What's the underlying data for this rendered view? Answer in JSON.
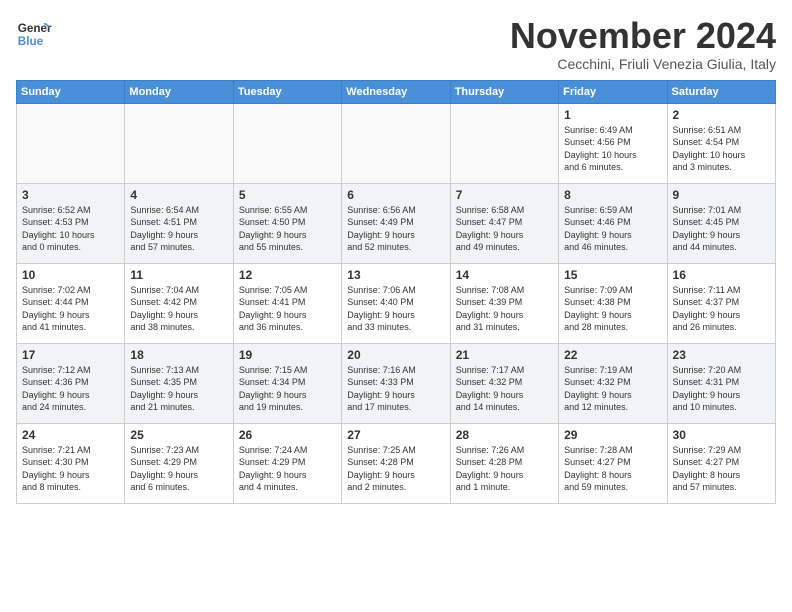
{
  "logo": {
    "line1": "General",
    "line2": "Blue"
  },
  "title": "November 2024",
  "subtitle": "Cecchini, Friuli Venezia Giulia, Italy",
  "days_of_week": [
    "Sunday",
    "Monday",
    "Tuesday",
    "Wednesday",
    "Thursday",
    "Friday",
    "Saturday"
  ],
  "weeks": [
    [
      {
        "day": "",
        "info": ""
      },
      {
        "day": "",
        "info": ""
      },
      {
        "day": "",
        "info": ""
      },
      {
        "day": "",
        "info": ""
      },
      {
        "day": "",
        "info": ""
      },
      {
        "day": "1",
        "info": "Sunrise: 6:49 AM\nSunset: 4:56 PM\nDaylight: 10 hours\nand 6 minutes."
      },
      {
        "day": "2",
        "info": "Sunrise: 6:51 AM\nSunset: 4:54 PM\nDaylight: 10 hours\nand 3 minutes."
      }
    ],
    [
      {
        "day": "3",
        "info": "Sunrise: 6:52 AM\nSunset: 4:53 PM\nDaylight: 10 hours\nand 0 minutes."
      },
      {
        "day": "4",
        "info": "Sunrise: 6:54 AM\nSunset: 4:51 PM\nDaylight: 9 hours\nand 57 minutes."
      },
      {
        "day": "5",
        "info": "Sunrise: 6:55 AM\nSunset: 4:50 PM\nDaylight: 9 hours\nand 55 minutes."
      },
      {
        "day": "6",
        "info": "Sunrise: 6:56 AM\nSunset: 4:49 PM\nDaylight: 9 hours\nand 52 minutes."
      },
      {
        "day": "7",
        "info": "Sunrise: 6:58 AM\nSunset: 4:47 PM\nDaylight: 9 hours\nand 49 minutes."
      },
      {
        "day": "8",
        "info": "Sunrise: 6:59 AM\nSunset: 4:46 PM\nDaylight: 9 hours\nand 46 minutes."
      },
      {
        "day": "9",
        "info": "Sunrise: 7:01 AM\nSunset: 4:45 PM\nDaylight: 9 hours\nand 44 minutes."
      }
    ],
    [
      {
        "day": "10",
        "info": "Sunrise: 7:02 AM\nSunset: 4:44 PM\nDaylight: 9 hours\nand 41 minutes."
      },
      {
        "day": "11",
        "info": "Sunrise: 7:04 AM\nSunset: 4:42 PM\nDaylight: 9 hours\nand 38 minutes."
      },
      {
        "day": "12",
        "info": "Sunrise: 7:05 AM\nSunset: 4:41 PM\nDaylight: 9 hours\nand 36 minutes."
      },
      {
        "day": "13",
        "info": "Sunrise: 7:06 AM\nSunset: 4:40 PM\nDaylight: 9 hours\nand 33 minutes."
      },
      {
        "day": "14",
        "info": "Sunrise: 7:08 AM\nSunset: 4:39 PM\nDaylight: 9 hours\nand 31 minutes."
      },
      {
        "day": "15",
        "info": "Sunrise: 7:09 AM\nSunset: 4:38 PM\nDaylight: 9 hours\nand 28 minutes."
      },
      {
        "day": "16",
        "info": "Sunrise: 7:11 AM\nSunset: 4:37 PM\nDaylight: 9 hours\nand 26 minutes."
      }
    ],
    [
      {
        "day": "17",
        "info": "Sunrise: 7:12 AM\nSunset: 4:36 PM\nDaylight: 9 hours\nand 24 minutes."
      },
      {
        "day": "18",
        "info": "Sunrise: 7:13 AM\nSunset: 4:35 PM\nDaylight: 9 hours\nand 21 minutes."
      },
      {
        "day": "19",
        "info": "Sunrise: 7:15 AM\nSunset: 4:34 PM\nDaylight: 9 hours\nand 19 minutes."
      },
      {
        "day": "20",
        "info": "Sunrise: 7:16 AM\nSunset: 4:33 PM\nDaylight: 9 hours\nand 17 minutes."
      },
      {
        "day": "21",
        "info": "Sunrise: 7:17 AM\nSunset: 4:32 PM\nDaylight: 9 hours\nand 14 minutes."
      },
      {
        "day": "22",
        "info": "Sunrise: 7:19 AM\nSunset: 4:32 PM\nDaylight: 9 hours\nand 12 minutes."
      },
      {
        "day": "23",
        "info": "Sunrise: 7:20 AM\nSunset: 4:31 PM\nDaylight: 9 hours\nand 10 minutes."
      }
    ],
    [
      {
        "day": "24",
        "info": "Sunrise: 7:21 AM\nSunset: 4:30 PM\nDaylight: 9 hours\nand 8 minutes."
      },
      {
        "day": "25",
        "info": "Sunrise: 7:23 AM\nSunset: 4:29 PM\nDaylight: 9 hours\nand 6 minutes."
      },
      {
        "day": "26",
        "info": "Sunrise: 7:24 AM\nSunset: 4:29 PM\nDaylight: 9 hours\nand 4 minutes."
      },
      {
        "day": "27",
        "info": "Sunrise: 7:25 AM\nSunset: 4:28 PM\nDaylight: 9 hours\nand 2 minutes."
      },
      {
        "day": "28",
        "info": "Sunrise: 7:26 AM\nSunset: 4:28 PM\nDaylight: 9 hours\nand 1 minute."
      },
      {
        "day": "29",
        "info": "Sunrise: 7:28 AM\nSunset: 4:27 PM\nDaylight: 8 hours\nand 59 minutes."
      },
      {
        "day": "30",
        "info": "Sunrise: 7:29 AM\nSunset: 4:27 PM\nDaylight: 8 hours\nand 57 minutes."
      }
    ]
  ]
}
